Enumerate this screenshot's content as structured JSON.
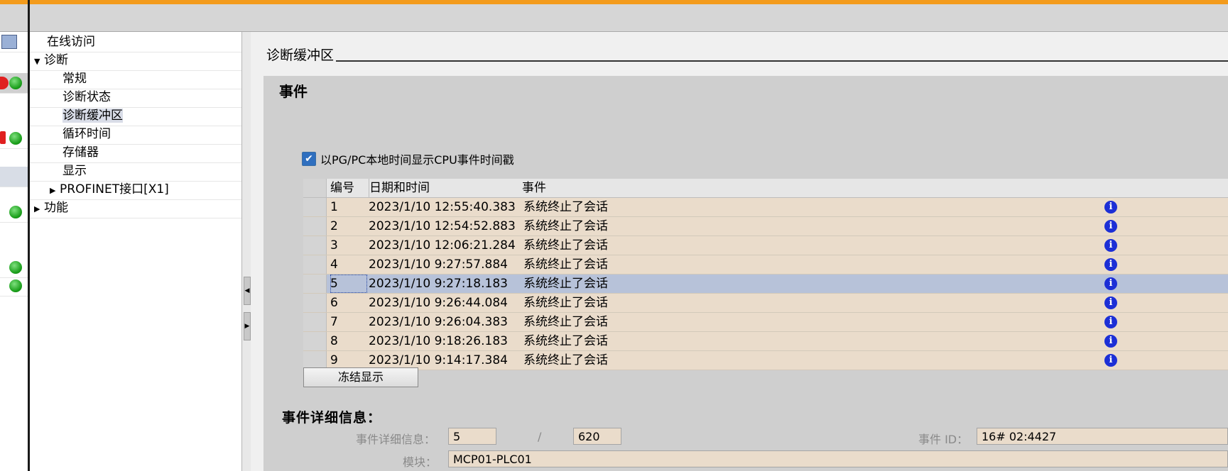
{
  "nav": {
    "items": [
      {
        "label": "在线访问",
        "arrow": "",
        "level": 1
      },
      {
        "label": "诊断",
        "arrow": "▼",
        "level": 0
      },
      {
        "label": "常规",
        "arrow": "",
        "level": 2
      },
      {
        "label": "诊断状态",
        "arrow": "",
        "level": 2
      },
      {
        "label": "诊断缓冲区",
        "arrow": "",
        "level": 2
      },
      {
        "label": "循环时间",
        "arrow": "",
        "level": 2
      },
      {
        "label": "存储器",
        "arrow": "",
        "level": 2
      },
      {
        "label": "显示",
        "arrow": "",
        "level": 2
      },
      {
        "label": "PROFINET接口[X1]",
        "arrow": "▶",
        "level": 1
      },
      {
        "label": "功能",
        "arrow": "▶",
        "level": 0
      }
    ]
  },
  "section": {
    "title": "诊断缓冲区"
  },
  "events": {
    "heading": "事件",
    "checkbox_label": "以PG/PC本地时间显示CPU事件时间戳",
    "checkbox_checked": true,
    "columns": [
      "编号",
      "日期和时间",
      "事件"
    ],
    "rows": [
      {
        "no": "1",
        "datetime": "2023/1/10 12:55:40.383",
        "event": "系统终止了会话"
      },
      {
        "no": "2",
        "datetime": "2023/1/10 12:54:52.883",
        "event": "系统终止了会话"
      },
      {
        "no": "3",
        "datetime": "2023/1/10 12:06:21.284",
        "event": "系统终止了会话"
      },
      {
        "no": "4",
        "datetime": "2023/1/10 9:27:57.884",
        "event": "系统终止了会话"
      },
      {
        "no": "5",
        "datetime": "2023/1/10 9:27:18.183",
        "event": "系统终止了会话",
        "selected": true
      },
      {
        "no": "6",
        "datetime": "2023/1/10 9:26:44.084",
        "event": "系统终止了会话"
      },
      {
        "no": "7",
        "datetime": "2023/1/10 9:26:04.383",
        "event": "系统终止了会话"
      },
      {
        "no": "8",
        "datetime": "2023/1/10 9:18:26.183",
        "event": "系统终止了会话"
      },
      {
        "no": "9",
        "datetime": "2023/1/10 9:14:17.384",
        "event": "系统终止了会话"
      }
    ],
    "info_icon": "info-icon",
    "freeze_button": "冻结显示"
  },
  "detail": {
    "heading": "事件详细信息：",
    "label_detail": "事件详细信息：",
    "current": "5",
    "separator": "/",
    "total": "620",
    "label_event_id": "事件 ID：",
    "event_id": "16# 02:4427",
    "label_module": "模块：",
    "module": "MCP01-PLC01"
  },
  "colors": {
    "accent": "#f39b1c",
    "row": "#eadccb",
    "row_selected": "#b7c2d9",
    "info": "#1c2fd6"
  }
}
